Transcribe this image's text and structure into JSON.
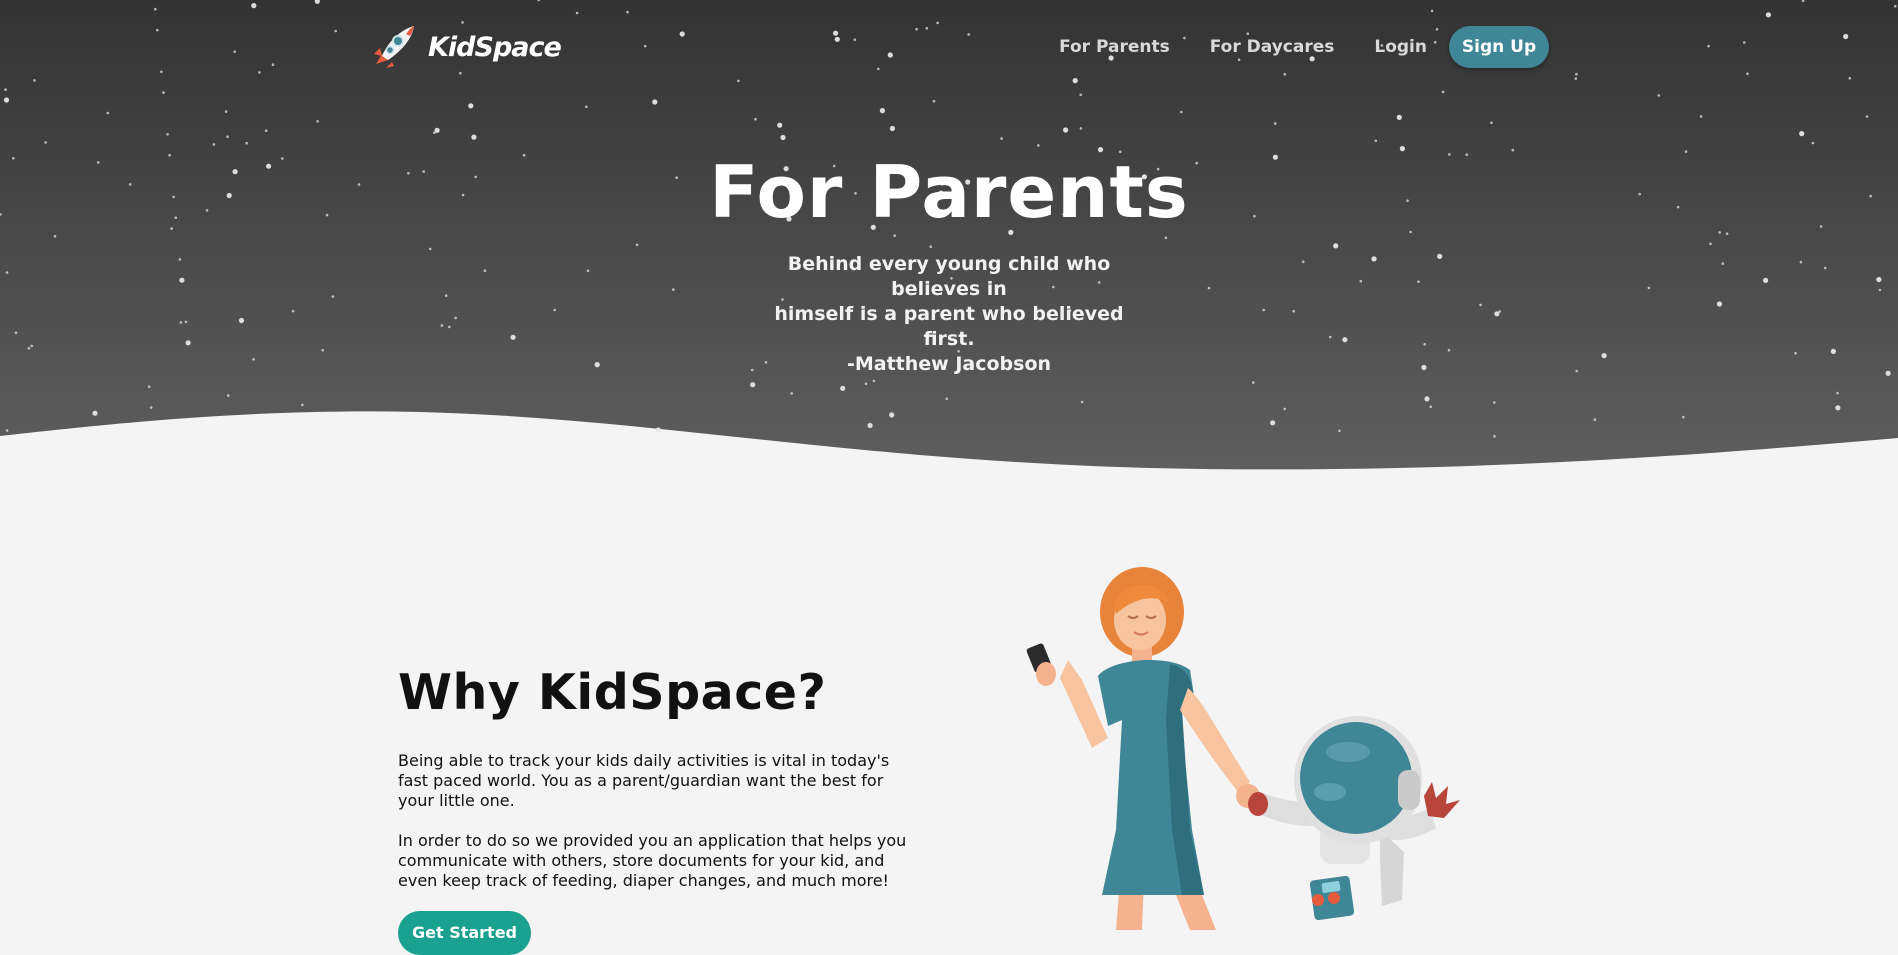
{
  "brand": {
    "name": "KidSpace"
  },
  "nav": {
    "links": [
      "For Parents",
      "For Daycares",
      "Login"
    ],
    "signup_label": "Sign Up"
  },
  "hero": {
    "title": "For Parents",
    "quote_line1": "Behind every young child who believes in",
    "quote_line2": "himself is a parent who believed first.",
    "quote_author": "-Matthew Jacobson"
  },
  "why": {
    "heading": "Why KidSpace?",
    "paragraph1": "Being able to track your kids daily activities is vital in today's fast paced world. You as a parent/guardian want the best for your little one.",
    "paragraph2": "In order to do so we provided you an application that helps you communicate with others, store documents for your kid, and even keep track of feeding, diaper changes, and much more!",
    "cta_label": "Get Started"
  },
  "colors": {
    "hero_top": "#333333",
    "hero_bottom": "#5c5c5c",
    "accent": "#3f8696",
    "cta": "#1aa190",
    "page_bg": "#f4f4f4"
  },
  "icons": [
    "rocket-icon"
  ]
}
